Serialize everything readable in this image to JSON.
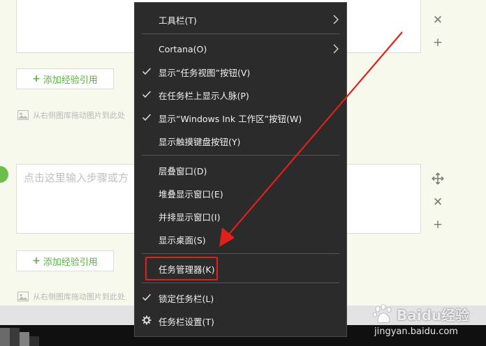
{
  "background": {
    "step_placeholder": "点击这里输入步骤或方",
    "add_reference_label": "添加经验引用",
    "image_hint": "从右侧图库拖动图片到此处"
  },
  "context_menu": {
    "items": [
      {
        "label": "工具栏(T)",
        "checked": false,
        "submenu": true
      },
      {
        "label": "Cortana(O)",
        "checked": false,
        "submenu": true
      },
      {
        "label": "显示“任务视图”按钮(V)",
        "checked": true,
        "submenu": false
      },
      {
        "label": "在任务栏上显示人脉(P)",
        "checked": true,
        "submenu": false
      },
      {
        "label": "显示“Windows Ink 工作区”按钮(W)",
        "checked": true,
        "submenu": false
      },
      {
        "label": "显示触摸键盘按钮(Y)",
        "checked": false,
        "submenu": false
      },
      {
        "label": "层叠窗口(D)",
        "checked": false,
        "submenu": false
      },
      {
        "label": "堆叠显示窗口(E)",
        "checked": false,
        "submenu": false
      },
      {
        "label": "并排显示窗口(I)",
        "checked": false,
        "submenu": false
      },
      {
        "label": "显示桌面(S)",
        "checked": false,
        "submenu": false
      },
      {
        "label": "任务管理器(K)",
        "checked": false,
        "submenu": false,
        "highlighted": true
      },
      {
        "label": "锁定任务栏(L)",
        "checked": true,
        "submenu": false
      },
      {
        "label": "任务栏设置(T)",
        "checked": false,
        "submenu": false,
        "icon": "gear-icon"
      }
    ]
  },
  "colors": {
    "menu_bg": "#2b2b2b",
    "annotation_red": "#e0211b",
    "accent_green": "#59b242"
  },
  "watermark": {
    "brand": "Baidu经验",
    "url": "jingyan.baidu.com"
  }
}
